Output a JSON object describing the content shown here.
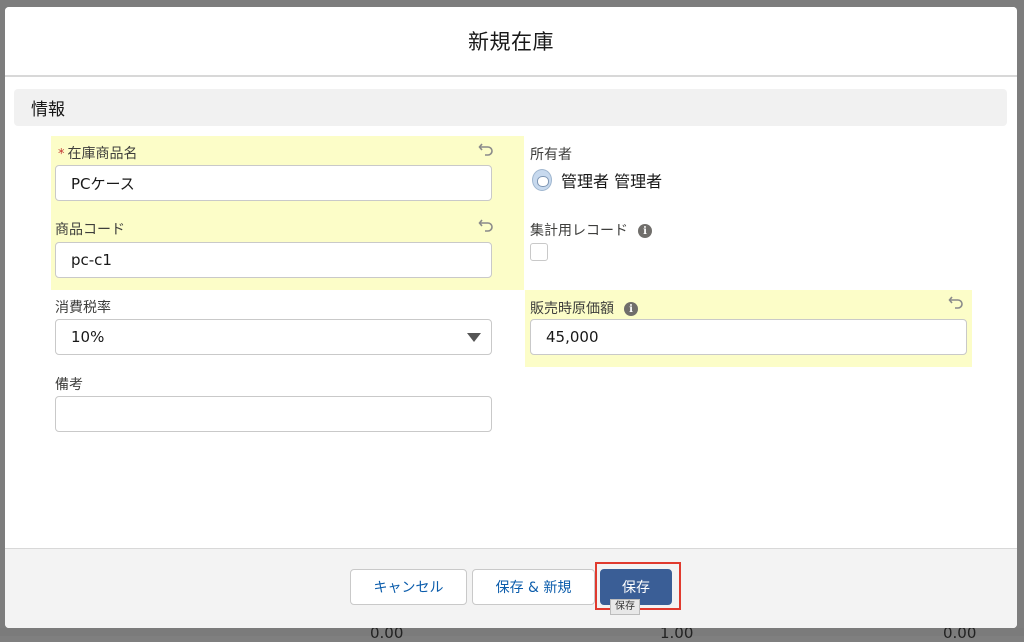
{
  "modal": {
    "title": "新規在庫",
    "section_title": "情報"
  },
  "left_fields": {
    "product_name": {
      "required_mark": "*",
      "label": "在庫商品名",
      "value": "PCケース"
    },
    "product_code": {
      "label": "商品コード",
      "value": "pc-c1"
    },
    "tax_rate": {
      "label": "消費税率",
      "value": "10%"
    },
    "notes": {
      "label": "備考",
      "value": ""
    }
  },
  "right_fields": {
    "owner": {
      "label": "所有者",
      "value": "管理者 管理者"
    },
    "summary_record": {
      "label": "集計用レコード",
      "checked": false
    },
    "cost_price": {
      "label": "販売時原価額",
      "value": "45,000"
    }
  },
  "footer": {
    "cancel_label": "キャンセル",
    "save_new_label": "保存 & 新規",
    "save_label": "保存",
    "save_tooltip": "保存"
  },
  "background": {
    "bottom_numbers": [
      "0.00",
      "1.00",
      "0.00"
    ]
  },
  "colors": {
    "highlight": "#fcfdc8",
    "brand_button": "#3a5e96",
    "link_text": "#0b5cab",
    "required": "#c23934",
    "focus_ring": "#e03a2e"
  },
  "icons": {
    "undo": "undo-icon",
    "info": "info-icon",
    "dropdown": "chevron-down-icon",
    "avatar": "user-avatar-icon"
  }
}
